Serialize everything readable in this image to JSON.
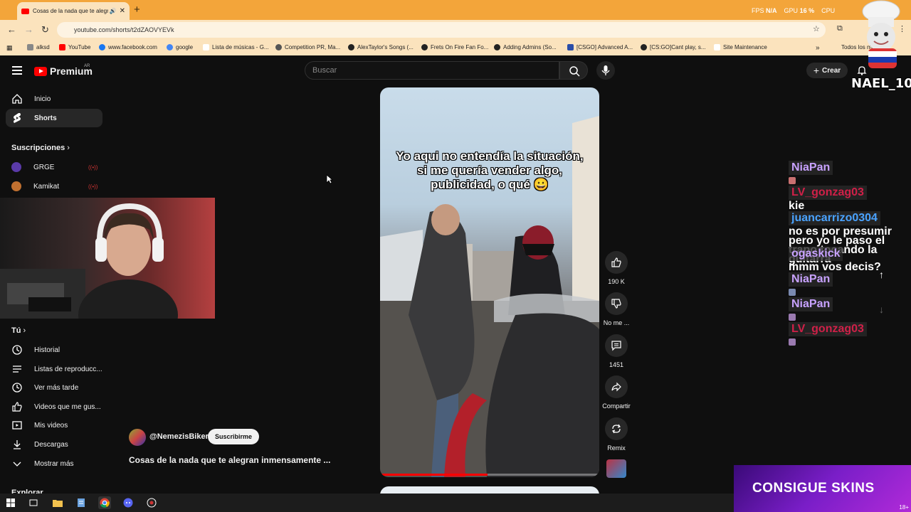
{
  "browser": {
    "tab_title": "Cosas de la nada que te alegran inmensamente ...",
    "url": "youtube.com/shorts/t2dZAOVYEVk",
    "perf": {
      "fps_label": "FPS",
      "fps_value": "N/A",
      "gpu_label": "GPU",
      "gpu_value": "16 %",
      "cpu_label": "CPU",
      "cpu_value": "N/A"
    },
    "bookmarks": [
      {
        "label": "alksd",
        "color": "#888888"
      },
      {
        "label": "YouTube",
        "color": "#ff0000"
      },
      {
        "label": "www.facebook.com",
        "color": "#1877f2"
      },
      {
        "label": "google",
        "color": "#4285f4"
      },
      {
        "label": "Lista de músicas - G...",
        "color": "#ffffff"
      },
      {
        "label": "Competition PR, Ma...",
        "color": "#555555"
      },
      {
        "label": "AlexTaylor's Songs (...",
        "color": "#222222"
      },
      {
        "label": "Frets On Fire Fan Fo...",
        "color": "#222222"
      },
      {
        "label": "Adding Admins (So...",
        "color": "#222222"
      },
      {
        "label": "[CSGO] Advanced A...",
        "color": "#2a4da8"
      },
      {
        "label": "[CS:GO]Cant play, s...",
        "color": "#222222"
      },
      {
        "label": "Site Maintenance",
        "color": "#ffffff"
      },
      {
        "label": "Todos los marcadores",
        "color": "#666666"
      }
    ]
  },
  "youtube": {
    "logo_text": "Premium",
    "logo_region": "AR",
    "search_placeholder": "Buscar",
    "create_label": "Crear",
    "sidebar": {
      "primary": [
        {
          "label": "Inicio",
          "icon": "home-icon"
        },
        {
          "label": "Shorts",
          "icon": "shorts-icon",
          "active": true
        }
      ],
      "subscriptions_heading": "Suscripciones",
      "subscriptions": [
        {
          "label": "GRGE",
          "color": "#5a3aa8"
        },
        {
          "label": "Kamikat",
          "color": "#c07030"
        }
      ],
      "you_heading": "Tú",
      "you_items": [
        {
          "label": "Historial",
          "icon": "history-icon"
        },
        {
          "label": "Listas de reproducc...",
          "icon": "playlist-icon"
        },
        {
          "label": "Ver más tarde",
          "icon": "clock-icon"
        },
        {
          "label": "Videos que me gus...",
          "icon": "thumbs-up-icon"
        },
        {
          "label": "Mis videos",
          "icon": "my-videos-icon"
        },
        {
          "label": "Descargas",
          "icon": "download-icon"
        },
        {
          "label": "Mostrar más",
          "icon": "chevron-down-icon"
        }
      ],
      "explore_heading": "Explorar"
    },
    "short": {
      "caption": "Yo aqui no entendía la situación, si me quería vender algo, publicidad, o qué 😀",
      "channel": "@NemezisBiker",
      "subscribe_label": "Suscribirme",
      "title": "Cosas de la nada que te alegran inmensamente ...",
      "progress": 0.49,
      "actions": {
        "like_count": "190 K",
        "dislike_label": "No me ...",
        "comments_count": "1451",
        "share_label": "Compartir",
        "remix_label": "Remix"
      }
    }
  },
  "overlay": {
    "streamer_name": "NAEL_1001",
    "chat": [
      {
        "user": "NiaPan",
        "text": "",
        "style": "purple"
      },
      {
        "user": "LV_gonzag03",
        "text": "kie",
        "style": "red"
      },
      {
        "user": "juancarrizo0304",
        "text": "no es por presumir pero yo le paso el trapo tocando la guitarra",
        "style": "blue"
      },
      {
        "user": "ogaskick",
        "text": "mmm vos decis?",
        "style": "purple"
      },
      {
        "user": "NiaPan",
        "text": "",
        "style": "purple"
      },
      {
        "user": "NiaPan",
        "text": "",
        "style": "purple"
      },
      {
        "user": "LV_gonzag03",
        "text": "",
        "style": "red"
      }
    ],
    "banner_text": "CONSIGUE SKINS",
    "age_label": "18+"
  }
}
